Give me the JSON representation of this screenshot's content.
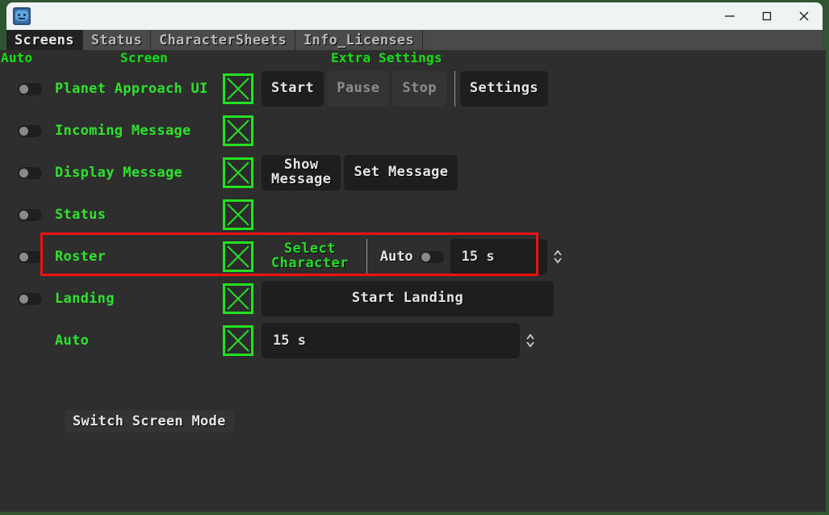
{
  "window": {
    "icon": "app-robot-icon",
    "controls": {
      "minimize": "minimize-icon",
      "maximize": "maximize-icon",
      "close": "close-icon"
    }
  },
  "tabs": [
    {
      "label": "Screens",
      "active": true
    },
    {
      "label": "Status",
      "active": false
    },
    {
      "label": "CharacterSheets",
      "active": false
    },
    {
      "label": "Info_Licenses",
      "active": false
    }
  ],
  "column_headers": {
    "auto": "Auto",
    "screen": "Screen",
    "extra": "Extra Settings"
  },
  "rows": [
    {
      "label": "Planet Approach UI",
      "toggle": "off",
      "checkbox": "x-mark",
      "buttons": [
        {
          "label": "Start",
          "state": "enabled"
        },
        {
          "label": "Pause",
          "state": "disabled"
        },
        {
          "label": "Stop",
          "state": "disabled"
        },
        {
          "label": "Settings",
          "state": "enabled"
        }
      ]
    },
    {
      "label": "Incoming Message",
      "toggle": "off",
      "checkbox": "x-mark",
      "buttons": []
    },
    {
      "label": "Display Message",
      "toggle": "off",
      "checkbox": "x-mark",
      "buttons": [
        {
          "label": "Show\nMessage",
          "state": "enabled"
        },
        {
          "label": "Set Message",
          "state": "enabled"
        }
      ]
    },
    {
      "label": "Status",
      "toggle": "off",
      "checkbox": "x-mark",
      "buttons": []
    },
    {
      "label": "Roster",
      "toggle": "off",
      "checkbox": "x-mark",
      "highlighted": true,
      "select_character_label": "Select\nCharacter",
      "auto_label": "Auto",
      "auto_toggle": "off",
      "interval_value": "15 s"
    },
    {
      "label": "Landing",
      "toggle": "off",
      "checkbox": "x-mark",
      "buttons": [
        {
          "label": "Start Landing",
          "state": "enabled"
        }
      ]
    },
    {
      "label": "Auto",
      "toggle": "none",
      "checkbox": "x-mark",
      "interval_value": "15 s"
    }
  ],
  "switch_screen_mode": "Switch Screen Mode",
  "colors": {
    "accent_green": "#23e023",
    "highlight_red": "#ee1111",
    "panel_bg": "#2e2e2e",
    "tabbar_bg": "#4a4a4a",
    "desktop_bg": "#2f5630"
  }
}
